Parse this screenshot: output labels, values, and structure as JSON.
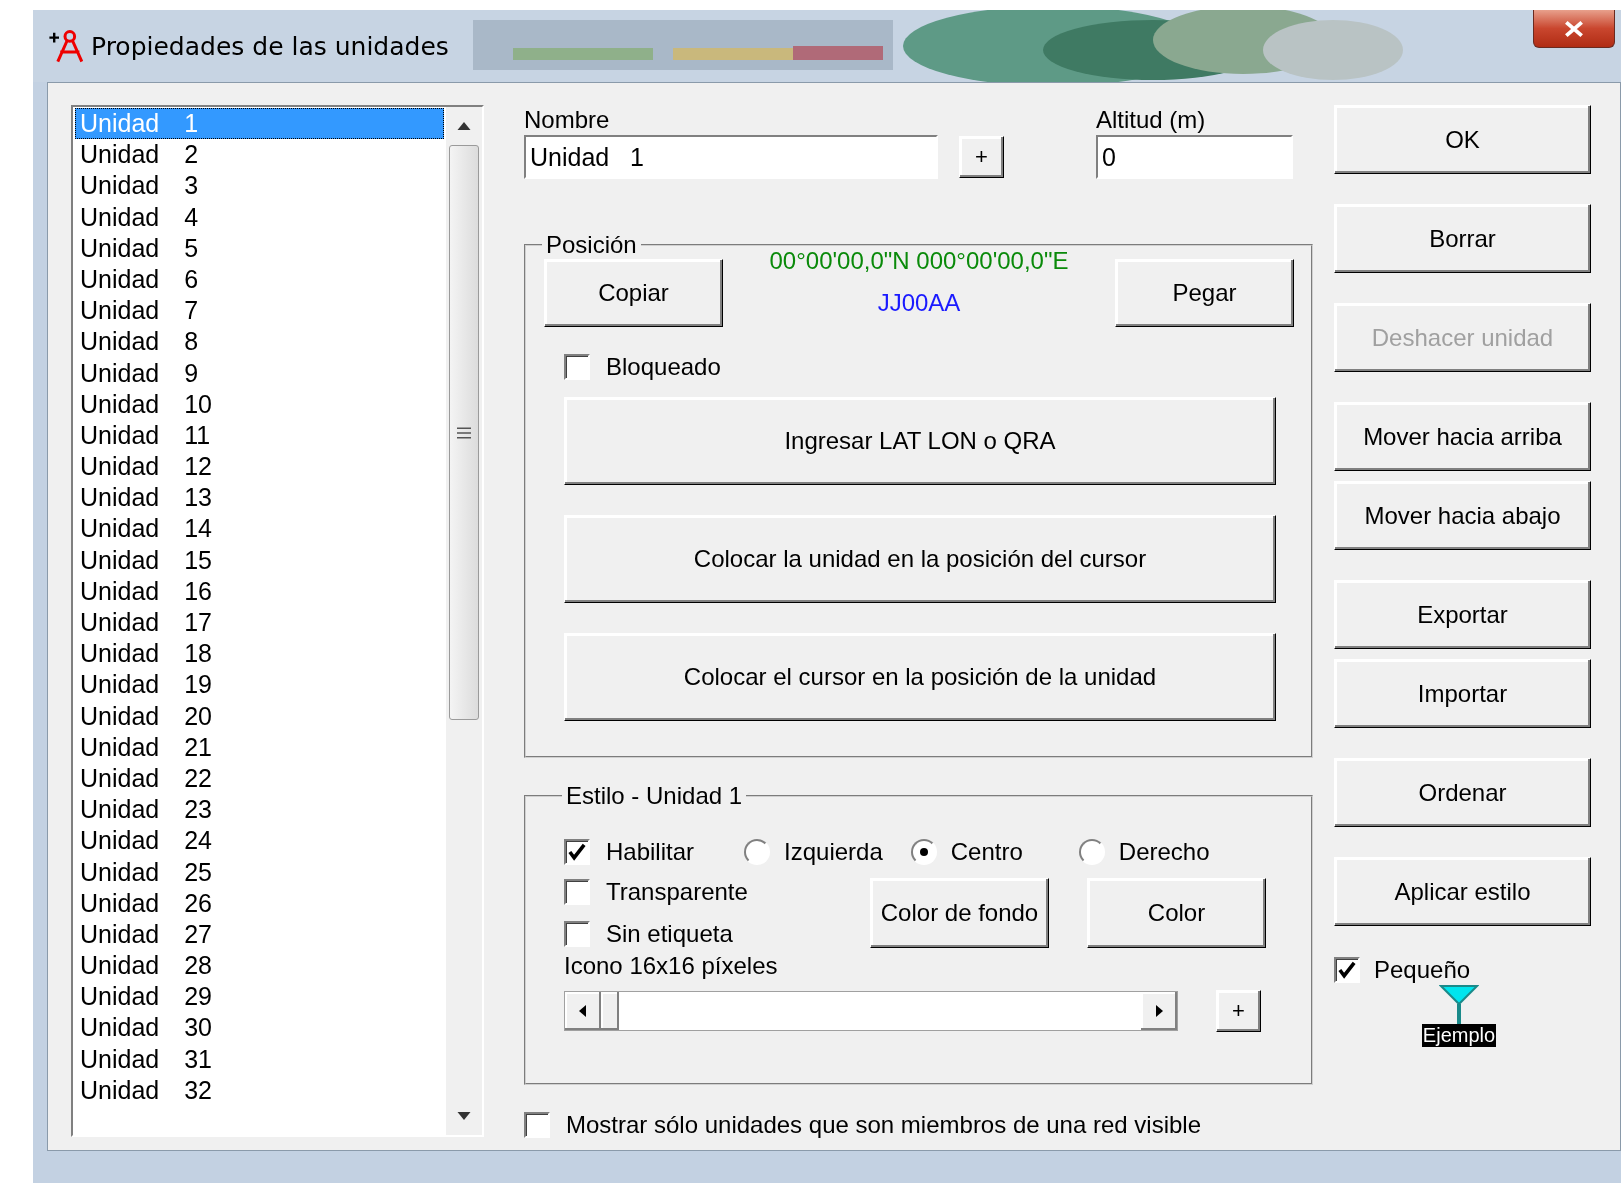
{
  "window": {
    "title": "Propiedades de las unidades"
  },
  "units": [
    {
      "label": "Unidad\t1",
      "selected": true
    },
    {
      "label": "Unidad\t2",
      "selected": false
    },
    {
      "label": "Unidad\t3",
      "selected": false
    },
    {
      "label": "Unidad\t4",
      "selected": false
    },
    {
      "label": "Unidad\t5",
      "selected": false
    },
    {
      "label": "Unidad\t6",
      "selected": false
    },
    {
      "label": "Unidad\t7",
      "selected": false
    },
    {
      "label": "Unidad\t8",
      "selected": false
    },
    {
      "label": "Unidad\t9",
      "selected": false
    },
    {
      "label": "Unidad\t10",
      "selected": false
    },
    {
      "label": "Unidad\t11",
      "selected": false
    },
    {
      "label": "Unidad\t12",
      "selected": false
    },
    {
      "label": "Unidad\t13",
      "selected": false
    },
    {
      "label": "Unidad\t14",
      "selected": false
    },
    {
      "label": "Unidad\t15",
      "selected": false
    },
    {
      "label": "Unidad\t16",
      "selected": false
    },
    {
      "label": "Unidad\t17",
      "selected": false
    },
    {
      "label": "Unidad\t18",
      "selected": false
    },
    {
      "label": "Unidad\t19",
      "selected": false
    },
    {
      "label": "Unidad\t20",
      "selected": false
    },
    {
      "label": "Unidad\t21",
      "selected": false
    },
    {
      "label": "Unidad\t22",
      "selected": false
    },
    {
      "label": "Unidad\t23",
      "selected": false
    },
    {
      "label": "Unidad\t24",
      "selected": false
    },
    {
      "label": "Unidad\t25",
      "selected": false
    },
    {
      "label": "Unidad\t26",
      "selected": false
    },
    {
      "label": "Unidad\t27",
      "selected": false
    },
    {
      "label": "Unidad\t28",
      "selected": false
    },
    {
      "label": "Unidad\t29",
      "selected": false
    },
    {
      "label": "Unidad\t30",
      "selected": false
    },
    {
      "label": "Unidad\t31",
      "selected": false
    },
    {
      "label": "Unidad\t32",
      "selected": false
    }
  ],
  "name_field": {
    "label": "Nombre",
    "value": "Unidad   1"
  },
  "name_add_button": "+",
  "altitude_field": {
    "label": "Altitud (m)",
    "value": "0"
  },
  "position": {
    "title": "Posición",
    "copy_button": "Copiar",
    "coordinates": "00°00'00,0\"N 000°00'00,0\"E",
    "locator": "JJ00AA",
    "paste_button": "Pegar",
    "locked": {
      "label": "Bloqueado",
      "checked": false
    },
    "actions": [
      "Ingresar LAT LON o QRA",
      "Colocar la unidad en la posición del cursor",
      "Colocar el cursor en la posición de la unidad"
    ]
  },
  "style": {
    "title": "Estilo - Unidad   1",
    "enable": {
      "label": "Habilitar",
      "checked": true
    },
    "alignment": [
      {
        "label": "Izquierda",
        "selected": false
      },
      {
        "label": "Centro",
        "selected": true
      },
      {
        "label": "Derecho",
        "selected": false
      }
    ],
    "transparent": {
      "label": "Transparente",
      "checked": false
    },
    "no_label": {
      "label": "Sin etiqueta",
      "checked": false
    },
    "background_color_button": "Color de fondo",
    "color_button": "Color",
    "icon_label": "Icono 16x16 píxeles",
    "icon_add_button": "+"
  },
  "side_buttons": [
    {
      "label": "OK",
      "disabled": false
    },
    {
      "label": "Borrar",
      "disabled": false
    },
    {
      "label": "Deshacer unidad",
      "disabled": true
    },
    {
      "label": "Mover hacia arriba",
      "disabled": false
    },
    {
      "label": "Mover hacia abajo",
      "disabled": false
    },
    {
      "label": "Exportar",
      "disabled": false
    },
    {
      "label": "Importar",
      "disabled": false
    },
    {
      "label": "Ordenar",
      "disabled": false
    },
    {
      "label": "Aplicar estilo",
      "disabled": false
    }
  ],
  "small": {
    "label": "Pequeño",
    "checked": true
  },
  "example_label": "Ejemplo",
  "members_only": {
    "label": "Mostrar sólo unidades que son miembros de una red visible",
    "checked": false
  }
}
